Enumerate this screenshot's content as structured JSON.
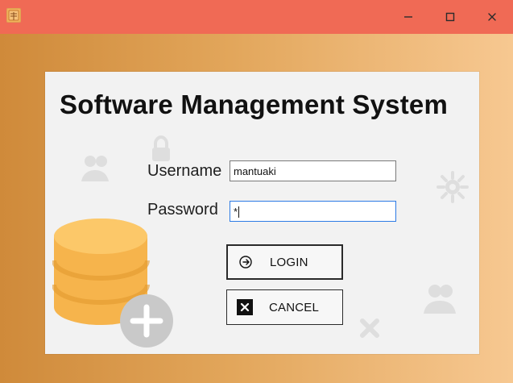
{
  "window": {
    "controls": {
      "minimize_icon": "minimize-icon",
      "maximize_icon": "maximize-icon",
      "close_icon": "close-icon"
    },
    "colors": {
      "titlebar": "#f06a55",
      "background_left": "#cf8a3a",
      "background_right": "#f7c891",
      "panel": "#f2f2f2"
    }
  },
  "main": {
    "title": "Software Management System",
    "username": {
      "label": "Username",
      "value": "mantuaki"
    },
    "password": {
      "label": "Password",
      "value": "*"
    },
    "buttons": {
      "login": "LOGIN",
      "cancel": "CANCEL"
    }
  }
}
